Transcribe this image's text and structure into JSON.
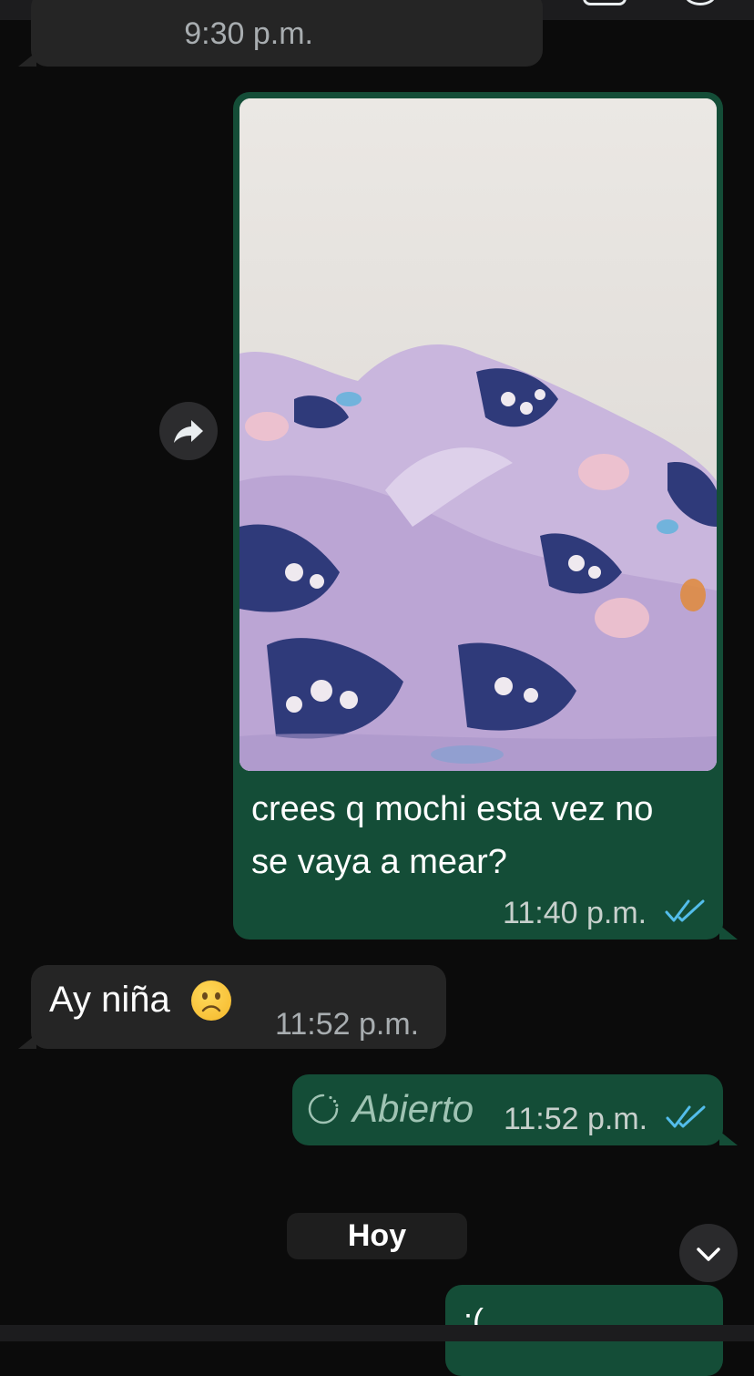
{
  "messages": {
    "previous": {
      "time": "9:30 p.m."
    },
    "photo": {
      "caption": "crees q mochi esta vez no se vaya a mear?",
      "time": "11:40 p.m."
    },
    "incoming": {
      "text": "Ay niña",
      "time": "11:52 p.m."
    },
    "opened": {
      "label": "Abierto",
      "time": "11:52 p.m."
    },
    "last": {
      "text": ":("
    }
  },
  "day_separator": "Hoy",
  "colors": {
    "background": "#0b0b0b",
    "incoming_bubble": "#252525",
    "outgoing_bubble": "#144d37",
    "read_ticks": "#53bdeb"
  }
}
